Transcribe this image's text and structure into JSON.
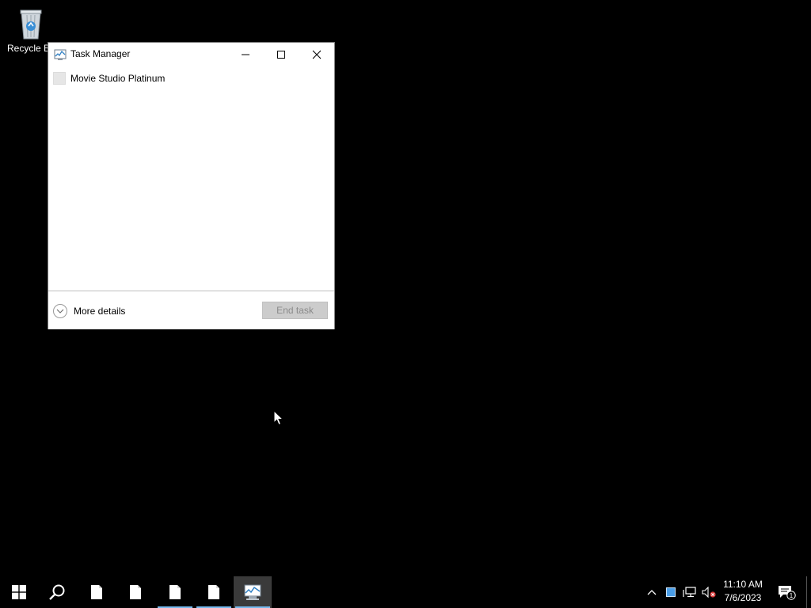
{
  "desktop": {
    "recycle_bin_label": "Recycle B"
  },
  "task_manager": {
    "title": "Task Manager",
    "processes": [
      {
        "name": "Movie Studio Platinum"
      }
    ],
    "more_details_label": "More details",
    "end_task_label": "End task",
    "end_task_enabled": false
  },
  "taskbar": {
    "items": [
      {
        "icon": "windows-start-icon"
      },
      {
        "icon": "search-icon"
      },
      {
        "icon": "document-icon",
        "running": false
      },
      {
        "icon": "document-icon",
        "running": false
      },
      {
        "icon": "document-icon",
        "running": true
      },
      {
        "icon": "document-icon",
        "running": true
      },
      {
        "icon": "task-manager-icon",
        "running": true,
        "active": true
      }
    ],
    "tray": {
      "clock_time": "11:10 AM",
      "clock_date": "7/6/2023",
      "notification_count": "1"
    }
  },
  "colors": {
    "taskbar_bg": "#000000",
    "running_underline": "#76b9ed",
    "active_item_bg": "#3a3a3a"
  }
}
